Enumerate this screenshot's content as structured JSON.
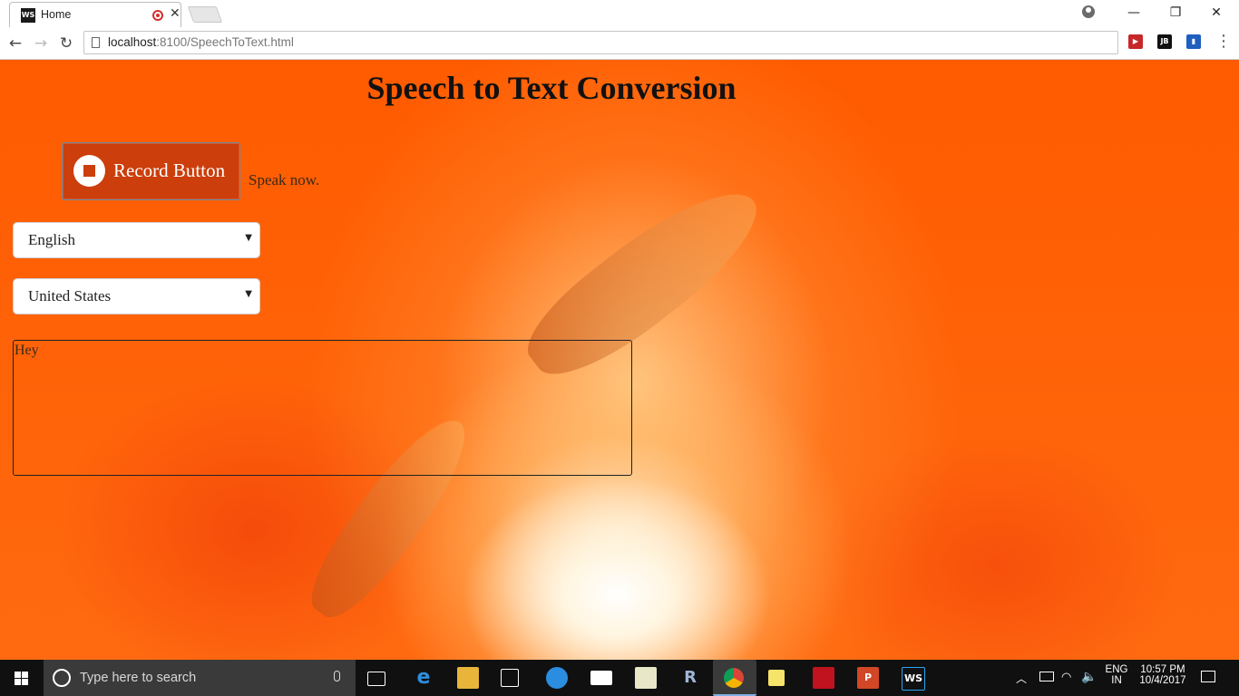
{
  "browser": {
    "tab_title": "Home",
    "tab_favicon": "WS",
    "url_host": "localhost",
    "url_path": ":8100/SpeechToText.html",
    "window_controls": {
      "minimize": "—",
      "restore": "❐",
      "close": "✕"
    },
    "nav": {
      "back": "←",
      "forward": "→",
      "reload": "↻"
    },
    "menu": "⋮",
    "extension_jb": "JB"
  },
  "page": {
    "title": "Speech to Text Conversion",
    "record_button_label": "Record Button",
    "status": "Speak now.",
    "language_select": {
      "selected": "English"
    },
    "dialect_select": {
      "selected": "United States"
    },
    "transcript": "Hey",
    "accent_color": "#ff5b00",
    "button_color": "#cc3e0b"
  },
  "taskbar": {
    "search_placeholder": "Type here to search",
    "lang_primary": "ENG",
    "lang_secondary": "IN",
    "time": "10:57 PM",
    "date": "10/4/2017",
    "pinned_icons": [
      "task-view-icon",
      "edge-icon",
      "file-explorer-icon",
      "store-icon",
      "safari-icon",
      "mail-icon",
      "rstudio-icon",
      "r-icon",
      "chrome-icon",
      "sticky-notes-icon",
      "acrobat-icon",
      "powerpoint-icon",
      "webstorm-icon"
    ]
  }
}
